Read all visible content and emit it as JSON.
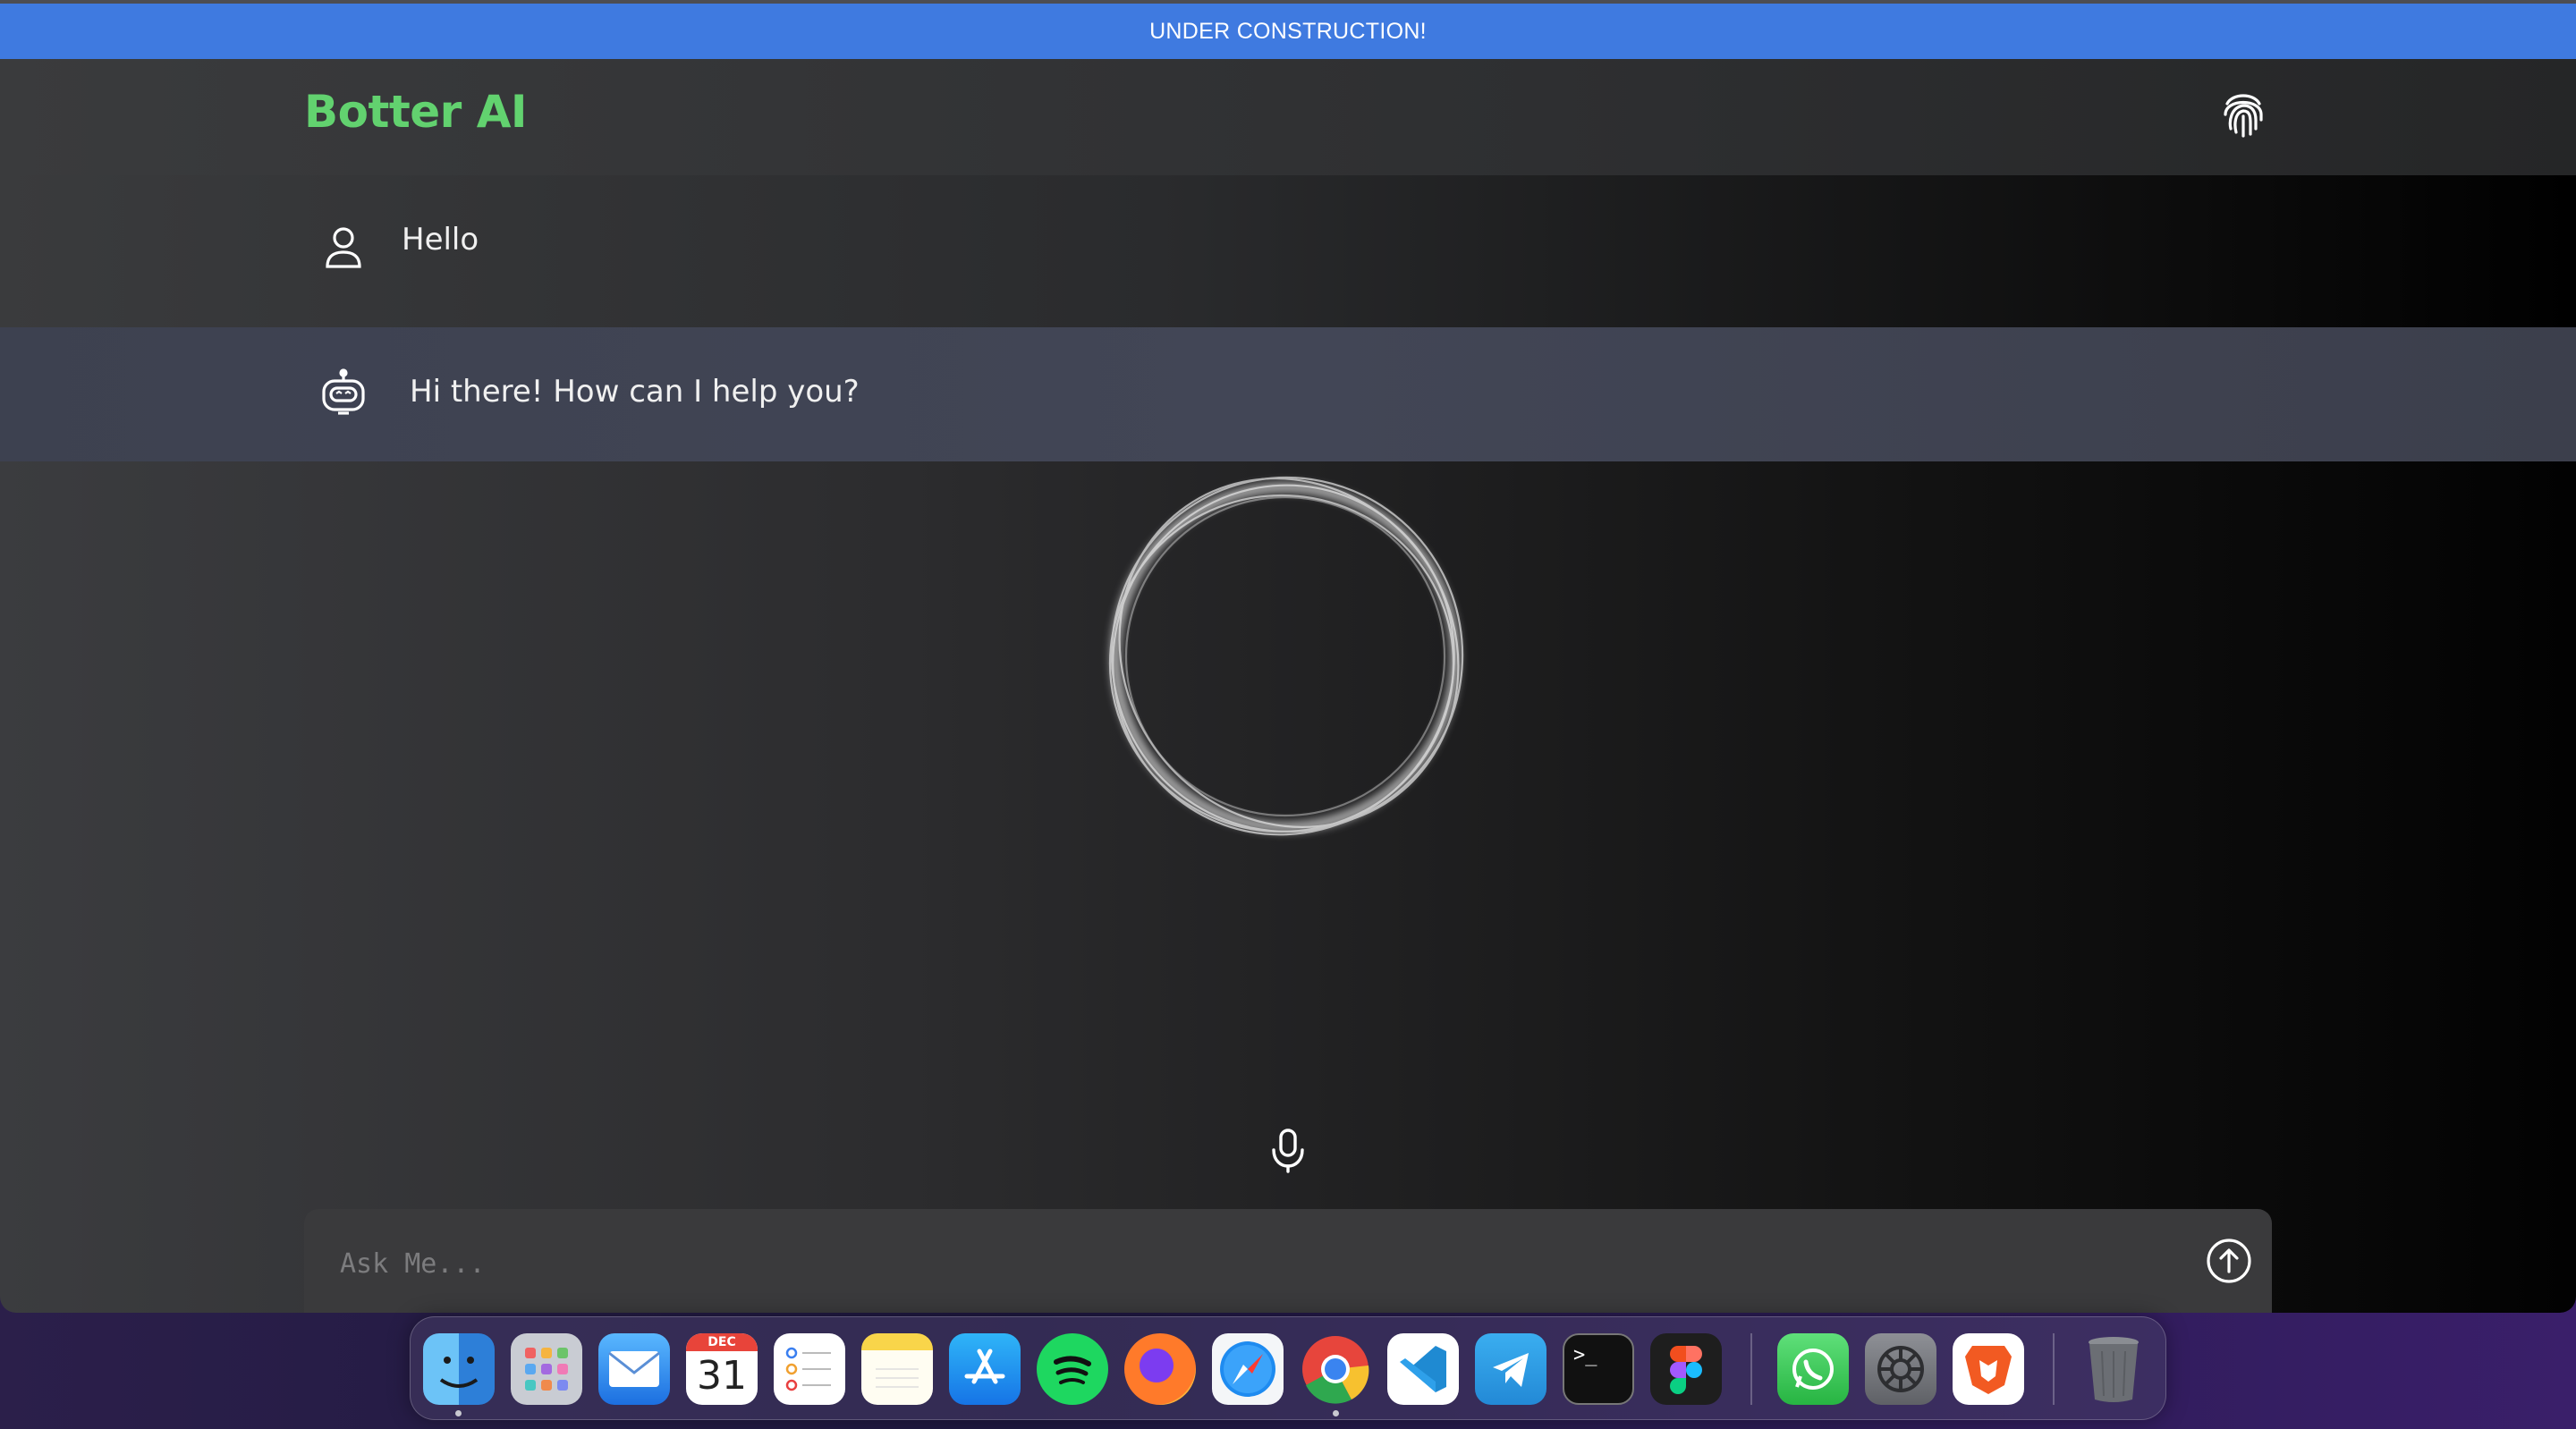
{
  "banner": {
    "text": "UNDER CONSTRUCTION!"
  },
  "header": {
    "brand": "Botter AI",
    "brand_color": "#62d26f"
  },
  "messages": [
    {
      "role": "user",
      "text": "Hello"
    },
    {
      "role": "bot",
      "text": "Hi there! How can I help you?"
    }
  ],
  "composer": {
    "placeholder": "Ask Me..."
  },
  "dock": {
    "apps": [
      {
        "name": "Finder",
        "icon": "finder-icon",
        "running": true
      },
      {
        "name": "Launchpad",
        "icon": "launchpad-icon"
      },
      {
        "name": "Mail",
        "icon": "mail-icon"
      },
      {
        "name": "Calendar",
        "icon": "calendar-icon",
        "month": "DEC",
        "day": "31"
      },
      {
        "name": "Reminders",
        "icon": "reminders-icon"
      },
      {
        "name": "Notes",
        "icon": "notes-icon"
      },
      {
        "name": "App Store",
        "icon": "app-store-icon"
      },
      {
        "name": "Spotify",
        "icon": "spotify-icon"
      },
      {
        "name": "Firefox",
        "icon": "firefox-icon"
      },
      {
        "name": "Safari",
        "icon": "safari-icon"
      },
      {
        "name": "Chrome",
        "icon": "chrome-icon",
        "running": true
      },
      {
        "name": "VS Code",
        "icon": "vscode-icon"
      },
      {
        "name": "Telegram",
        "icon": "telegram-icon"
      },
      {
        "name": "Terminal",
        "icon": "terminal-icon",
        "glyph": ">_"
      },
      {
        "name": "Figma",
        "icon": "figma-icon"
      },
      {
        "name": "WhatsApp",
        "icon": "whatsapp-icon"
      },
      {
        "name": "System Settings",
        "icon": "settings-icon"
      },
      {
        "name": "Brave",
        "icon": "brave-icon"
      },
      {
        "name": "Trash",
        "icon": "trash-icon"
      }
    ]
  }
}
